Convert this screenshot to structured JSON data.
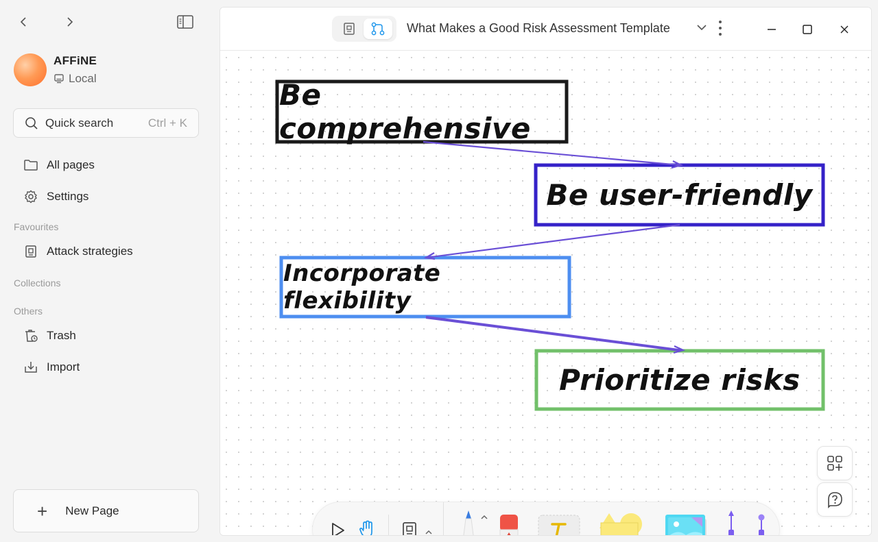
{
  "sidebar": {
    "workspace": {
      "name": "AFFiNE",
      "storage": "Local"
    },
    "search": {
      "label": "Quick search",
      "shortcut": "Ctrl + K"
    },
    "nav": [
      {
        "label": "All pages",
        "icon": "folder-icon"
      },
      {
        "label": "Settings",
        "icon": "gear-icon"
      }
    ],
    "sections": {
      "favourites": "Favourites",
      "collections": "Collections",
      "others": "Others"
    },
    "favourites": [
      {
        "label": "Attack strategies",
        "icon": "page-icon"
      }
    ],
    "others": [
      {
        "label": "Trash",
        "icon": "trash-icon"
      },
      {
        "label": "Import",
        "icon": "import-icon"
      }
    ],
    "new_page_label": "New Page"
  },
  "header": {
    "title": "What Makes a Good Risk Assessment Template",
    "mode": "edgeless"
  },
  "canvas": {
    "notes": [
      {
        "text": "Be comprehensive",
        "border_color": "#1a1a1a"
      },
      {
        "text": "Be user-friendly",
        "border_color": "#3522c8"
      },
      {
        "text": "Incorporate flexibility",
        "border_color": "#4d8ef0"
      },
      {
        "text": "Prioritize risks",
        "border_color": "#72c06a"
      }
    ],
    "connector_color": "#6a4fd6"
  },
  "toolbar": {
    "tools": [
      "pointer-icon",
      "hand-icon",
      "note-icon",
      "pen-icon",
      "eraser-icon",
      "text-icon",
      "shape-icon",
      "image-icon",
      "connector-icon"
    ]
  }
}
